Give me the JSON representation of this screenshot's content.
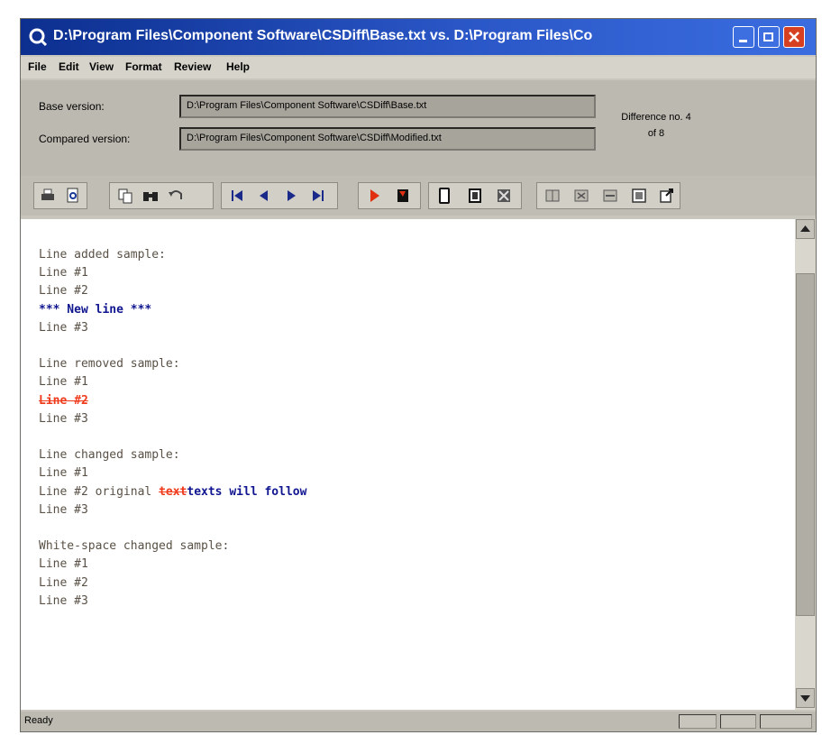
{
  "window": {
    "title": "D:\\Program Files\\Component Software\\CSDiff\\Base.txt vs. D:\\Program Files\\Co"
  },
  "menu": [
    "File",
    "Edit",
    "View",
    "Format",
    "Review",
    "Help"
  ],
  "info": {
    "base_label": "Base version:",
    "base_path": "D:\\Program Files\\Component Software\\CSDiff\\Base.txt",
    "compared_label": "Compared version:",
    "compared_path": "D:\\Program Files\\Component Software\\CSDiff\\Modified.txt",
    "difference_line1": "Difference no. 4",
    "difference_line2": "of 8"
  },
  "toolbar": {
    "icons": [
      "print-icon",
      "print-preview-icon",
      "copy-icon",
      "find-icon",
      "undo-icon",
      "first-diff-icon",
      "prev-diff-icon",
      "next-diff-icon",
      "last-diff-icon",
      "play-icon",
      "flag-icon",
      "page-icon",
      "pages-icon",
      "options-icon",
      "tile-icon",
      "compare-icon",
      "merge-icon",
      "window-icon",
      "export-icon"
    ]
  },
  "content": {
    "added_header": "Line added sample:",
    "added_l1": "Line #1",
    "added_l2": "Line #2",
    "added_new": "*** New line ***",
    "added_l3": "Line #3",
    "removed_header": "Line removed sample:",
    "removed_l1": "Line #1",
    "removed_l2": "Line #2",
    "removed_l3": "Line #3",
    "changed_header": "Line changed sample:",
    "changed_l1": "Line #1",
    "changed_l2_prefix": "Line #2 original ",
    "changed_l2_removed": "text",
    "changed_l2_added": "texts will follow",
    "changed_l3": "Line #3",
    "ws_header": "White-space changed sample:",
    "ws_l1": "Line #1",
    "ws_l2": "Line #2",
    "ws_l3": "Line #3"
  },
  "status": {
    "text": "Ready"
  }
}
